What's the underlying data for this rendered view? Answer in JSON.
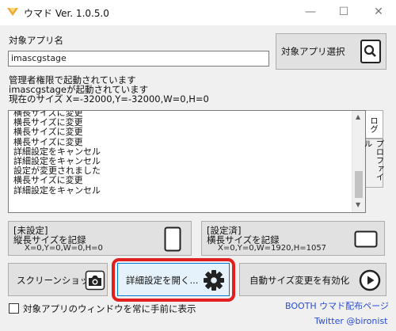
{
  "window": {
    "title": "ウマド Ver. 1.0.5.0",
    "minimize": "—",
    "maximize": "☐",
    "close": "✕"
  },
  "target": {
    "label": "対象アプリ名",
    "value": "imascgstage",
    "select_button": "対象アプリ選択"
  },
  "status": {
    "line1": "管理者権限で起動されています",
    "line2": "imascgstageが起動されています",
    "line3": "現在のサイズ X=-32000,Y=-32000,W=0,H=0"
  },
  "log": {
    "lines": [
      "横長サイズに変更",
      "横長サイズに変更",
      "横長サイズに変更",
      "横長サイズに変更",
      "詳細設定をキャンセル",
      "詳細設定をキャンセル",
      "設定が変更されました",
      "横長サイズに変更",
      "詳細設定をキャンセル"
    ]
  },
  "tabs": {
    "log": "ログ",
    "profile": "プロファイル"
  },
  "portrait": {
    "title": "[未設定]",
    "subtitle": "縦長サイズを記録",
    "coords": "X=0,Y=0,W=0,H=0"
  },
  "landscape": {
    "title": "[設定済]",
    "subtitle": "横長サイズを記録",
    "coords": "X=0,Y=0,W=1920,H=1057"
  },
  "buttons": {
    "screenshot": "スクリーンショット",
    "advanced": "詳細設定を開く...",
    "auto_resize": "自動サイズ変更を有効化"
  },
  "always_on_top": "対象アプリのウィンドウを常に手前に表示",
  "links": {
    "booth": "BOOTH ウマド配布ページ",
    "twitter": "Twitter @bironist"
  },
  "colors": {
    "highlight": "#e02020",
    "link": "#2a4bd7",
    "accent_icon": "#2b7cd6"
  },
  "icons": [
    "app-icon",
    "magnifier-icon",
    "phone-portrait-icon",
    "phone-landscape-icon",
    "camera-icon",
    "gear-icon",
    "play-icon"
  ]
}
